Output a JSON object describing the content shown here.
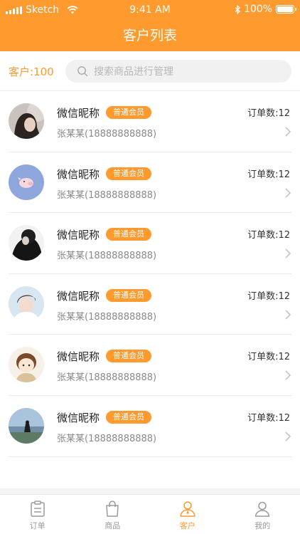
{
  "status_bar": {
    "carrier": "Sketch",
    "time": "9:41 AM",
    "battery": "100%",
    "battery_level": 1.0
  },
  "header": {
    "title": "客户列表"
  },
  "search": {
    "count_label": "客户:100",
    "placeholder": "搜索商品进行管理"
  },
  "customers": [
    {
      "nickname": "微信昵称",
      "badge": "普通会员",
      "phone": "张某某(18888888888)",
      "orders": "订单数:12"
    },
    {
      "nickname": "微信昵称",
      "badge": "普通会员",
      "phone": "张某某(18888888888)",
      "orders": "订单数:12"
    },
    {
      "nickname": "微信昵称",
      "badge": "普通会员",
      "phone": "张某某(18888888888)",
      "orders": "订单数:12"
    },
    {
      "nickname": "微信昵称",
      "badge": "普通会员",
      "phone": "张某某(18888888888)",
      "orders": "订单数:12"
    },
    {
      "nickname": "微信昵称",
      "badge": "普通会员",
      "phone": "张某某(18888888888)",
      "orders": "订单数:12"
    },
    {
      "nickname": "微信昵称",
      "badge": "普通会员",
      "phone": "张某某(18888888888)",
      "orders": "订单数:12"
    }
  ],
  "tabs": [
    {
      "label": "订单",
      "icon": "clipboard-icon",
      "active": false
    },
    {
      "label": "商品",
      "icon": "shopping-bag-icon",
      "active": false
    },
    {
      "label": "客户",
      "icon": "customer-icon",
      "active": true
    },
    {
      "label": "我的",
      "icon": "person-icon",
      "active": false
    }
  ],
  "colors": {
    "accent": "#ff9a2e",
    "muted": "#9a9a9a"
  }
}
